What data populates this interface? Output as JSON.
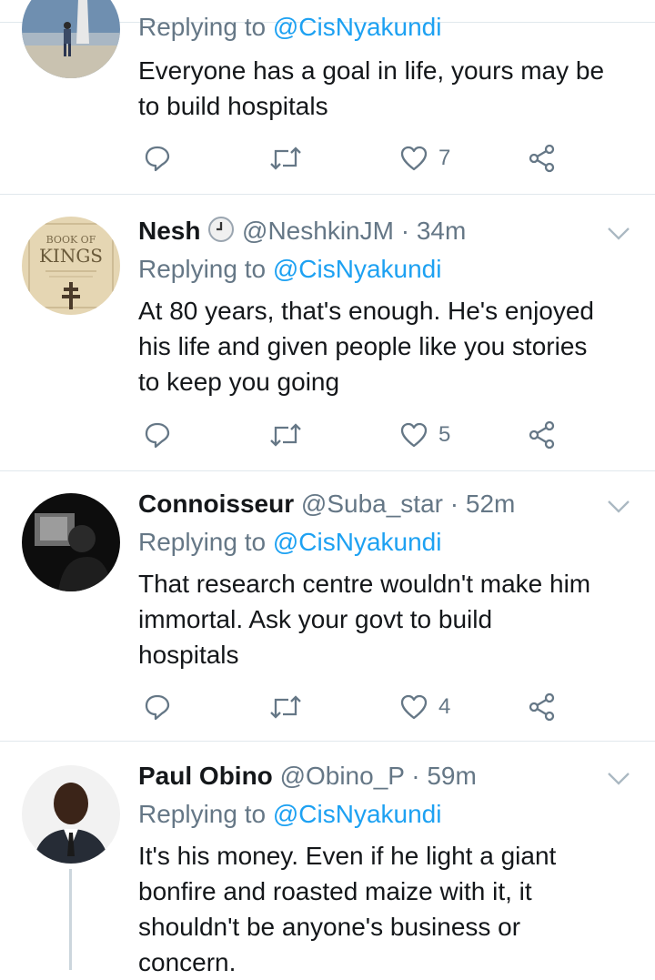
{
  "tweets": [
    {
      "name": "",
      "handle": "",
      "time": "",
      "replying_label": "Replying to",
      "replying_to": "@CisNyakundi",
      "lines": [
        "Everyone has a goal in life, yours may be",
        "to build hospitals"
      ],
      "likes": "7",
      "avatar": "man-on-cliff-photo"
    },
    {
      "name": "Nesh",
      "handle": "@NeshkinJM",
      "time": "34m",
      "replying_label": "Replying to",
      "replying_to": "@CisNyakundi",
      "lines": [
        "At 80 years, that's enough. He's enjoyed",
        "his life and given people like you stories",
        "to keep you going"
      ],
      "likes": "5",
      "avatar": "book-of-kings-cover",
      "avatar_text": [
        "BOOK OF",
        "KINGS"
      ]
    },
    {
      "name": "Connoisseur",
      "handle": "@Suba_star",
      "time": "52m",
      "replying_label": "Replying to",
      "replying_to": "@CisNyakundi",
      "lines": [
        "That research centre wouldn't make him",
        "immortal. Ask your govt to build",
        "hospitals"
      ],
      "likes": "4",
      "avatar": "dark-portrait-photo"
    },
    {
      "name": "Paul Obino",
      "handle": "@Obino_P",
      "time": "59m",
      "replying_label": "Replying to",
      "replying_to": "@CisNyakundi",
      "lines": [
        "It's his money. Even if he light a giant",
        "bonfire and roasted maize with it, it",
        "shouldn't be anyone's business or",
        "concern."
      ],
      "likes": "",
      "avatar": "man-in-suit-photo"
    }
  ],
  "separator": "·",
  "emoji": "clock-emoji",
  "icons": [
    "reply-icon",
    "retweet-icon",
    "like-icon",
    "share-icon",
    "chevron-down-icon"
  ],
  "colors": {
    "link": "#1da1f2",
    "muted": "#657786",
    "text": "#14171a",
    "divider": "#e1e8ed",
    "icon": "#657786"
  }
}
